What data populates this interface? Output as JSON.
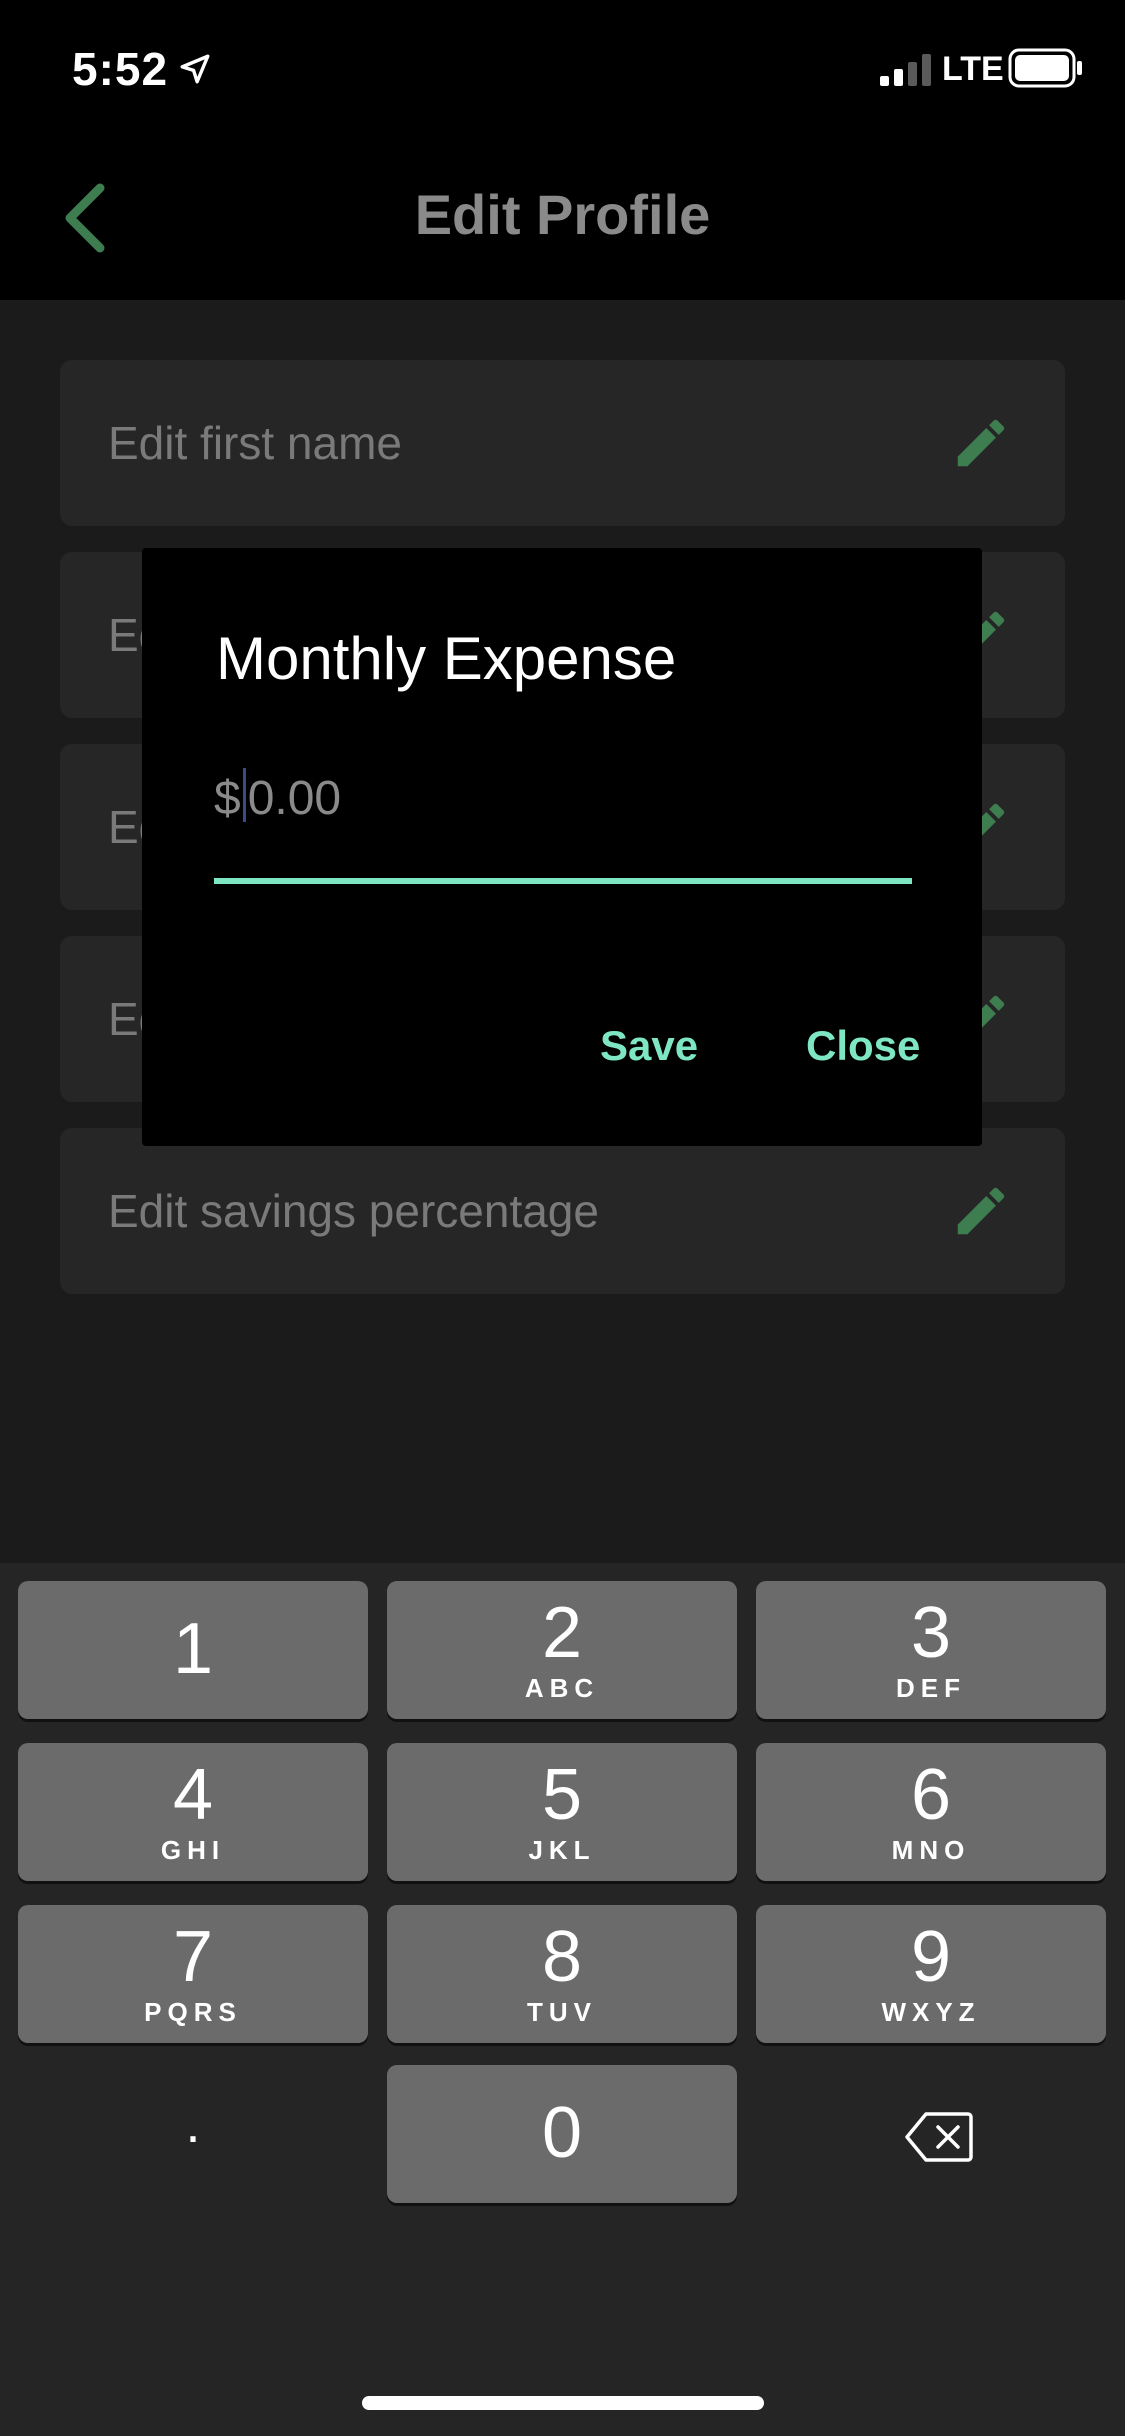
{
  "status_bar": {
    "time": "5:52",
    "network": "LTE"
  },
  "nav": {
    "title": "Edit Profile"
  },
  "list": {
    "rows": [
      {
        "label": "Edit first name"
      },
      {
        "label": "Ed"
      },
      {
        "label": "Ed"
      },
      {
        "label": "Ed"
      },
      {
        "label": "Edit savings percentage"
      }
    ]
  },
  "dialog": {
    "title": "Monthly Expense",
    "currency_prefix": "$",
    "amount_placeholder": "0.00",
    "save_label": "Save",
    "close_label": "Close",
    "accent_color": "#7ee6c2"
  },
  "keyboard": {
    "keys": [
      {
        "digit": "1",
        "letters": ""
      },
      {
        "digit": "2",
        "letters": "ABC"
      },
      {
        "digit": "3",
        "letters": "DEF"
      },
      {
        "digit": "4",
        "letters": "GHI"
      },
      {
        "digit": "5",
        "letters": "JKL"
      },
      {
        "digit": "6",
        "letters": "MNO"
      },
      {
        "digit": "7",
        "letters": "PQRS"
      },
      {
        "digit": "8",
        "letters": "TUV"
      },
      {
        "digit": "9",
        "letters": "WXYZ"
      },
      {
        "digit": "0",
        "letters": ""
      }
    ],
    "dot_label": ".",
    "delete_icon": "backspace-icon"
  }
}
